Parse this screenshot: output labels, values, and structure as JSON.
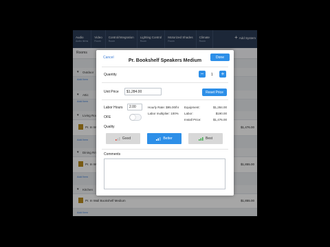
{
  "background_app": {
    "nav_tabs": [
      {
        "title": "Audio",
        "sub": "Audio items"
      },
      {
        "title": "Video",
        "sub": "Room"
      },
      {
        "title": "Control/Integration",
        "sub": "Room"
      },
      {
        "title": "Lighting Control",
        "sub": "Room"
      },
      {
        "title": "Motorized Shades",
        "sub": "Room"
      },
      {
        "title": "Climate",
        "sub": "Room"
      }
    ],
    "add_button_label": "Add System",
    "pane_title": "Rooms",
    "sections": [
      "Outdoor",
      "Attic",
      "Living Room",
      "Dining Rm",
      "Kitchen"
    ],
    "add_item_label": "Add Item",
    "rows": [
      {
        "name": "Pr. In Wall",
        "price": "$1,476.00"
      },
      {
        "name": "Pr. In Wall",
        "price": "$1,855.00"
      },
      {
        "name": "Pr. In Wall Bookshelf Medium",
        "price": "$1,855.00"
      }
    ]
  },
  "modal": {
    "title": "Pr. Bookshelf Speakers Medium",
    "cancel_label": "Cancel",
    "done_label": "Done",
    "quantity_label": "Quantity",
    "quantity_value": "1",
    "minus_symbol": "−",
    "plus_symbol": "+",
    "unit_price_label": "Unit Price",
    "unit_price_value": "$1,284.00",
    "reset_price_label": "Reset Price",
    "labor_hours_label": "Labor Hours",
    "labor_hours_value": "2.00",
    "ofe_label": "OFE",
    "ofe_on": false,
    "hourly_rate_text": "Hourly Rate: $95.00/hr",
    "labor_multiplier_text": "Labor multiplier: 100%",
    "equipment_label": "Equipment:",
    "equipment_value": "$1,284.00",
    "labor_label": "Labor:",
    "labor_value": "$190.00",
    "install_price_label": "Install Price:",
    "install_price_value": "$1,476.00",
    "quality_label": "Quality",
    "quality_options": [
      {
        "label": "Good",
        "color": "#e0453a"
      },
      {
        "label": "Better",
        "color": "#ffffff"
      },
      {
        "label": "Best",
        "color": "#3daa4a"
      }
    ],
    "quality_selected": "Better",
    "comments_label": "Comments",
    "comments_value": ""
  },
  "colors": {
    "accent": "#2d8fe8",
    "nav_bg": "#2b3c57"
  }
}
